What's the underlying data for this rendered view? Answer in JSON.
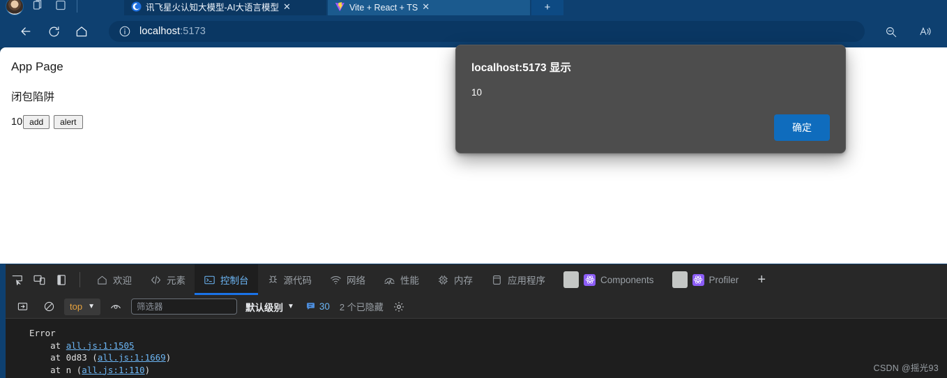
{
  "browser": {
    "tabs": [
      {
        "title": "讯飞星火认知大模型-AI大语言模型",
        "favicon": "spark-icon",
        "close": "✕",
        "active": false
      },
      {
        "title": "Vite + React + TS",
        "favicon": "vite-icon",
        "close": "✕",
        "active": true
      }
    ],
    "new_tab_label": "+",
    "toolbar": {
      "back": "back-arrow-icon",
      "refresh": "refresh-icon",
      "home": "home-icon",
      "site_info": "info-icon",
      "url_host": "localhost",
      "url_port": ":5173",
      "zoom_out": "zoom-out-icon",
      "read_aloud": "read-aloud-icon"
    },
    "chrome_icons": {
      "profile": "avatar",
      "tab_actions": "copy-tabs-icon",
      "split_screen": "split-screen-icon"
    }
  },
  "page": {
    "heading": "App Page",
    "subheading": "闭包陷阱",
    "counter_value": "10",
    "buttons": [
      {
        "label": "add"
      },
      {
        "label": "alert"
      }
    ]
  },
  "dialog": {
    "title": "localhost:5173 显示",
    "message": "10",
    "confirm_label": "确定"
  },
  "devtools": {
    "rail_icons": [
      {
        "name": "inspect-element-icon"
      },
      {
        "name": "device-toolbar-icon"
      },
      {
        "name": "dock-side-icon"
      }
    ],
    "tabs": [
      {
        "label": "欢迎",
        "icon": "home-icon",
        "active": false,
        "type": "icon"
      },
      {
        "label": "元素",
        "icon": "code-brackets-icon",
        "active": false,
        "type": "icon"
      },
      {
        "label": "控制台",
        "icon": "console-terminal-icon",
        "active": true,
        "type": "icon"
      },
      {
        "label": "源代码",
        "icon": "bug-sources-icon",
        "active": false,
        "type": "icon"
      },
      {
        "label": "网络",
        "icon": "wifi-network-icon",
        "active": false,
        "type": "icon"
      },
      {
        "label": "性能",
        "icon": "performance-gauge-icon",
        "active": false,
        "type": "icon"
      },
      {
        "label": "内存",
        "icon": "memory-chip-icon",
        "active": false,
        "type": "icon"
      },
      {
        "label": "应用程序",
        "icon": "application-storage-icon",
        "active": false,
        "type": "icon"
      },
      {
        "label": "Components",
        "icon": "react-atom-icon",
        "active": false,
        "type": "react"
      },
      {
        "label": "Profiler",
        "icon": "react-atom-icon",
        "active": false,
        "type": "react"
      }
    ],
    "more_tabs_label": "+",
    "filterbar": {
      "sidebar_toggle": "console-sidebar-icon",
      "clear_console": "clear-console-icon",
      "context_value": "top",
      "context_caret": "▼",
      "live_expression": "eye-icon",
      "filter_placeholder": "筛选器",
      "level_label": "默认级别",
      "level_caret": "▼",
      "info_icon": "info-message-icon",
      "info_count": "30",
      "hidden_count": "2 个已隐藏",
      "settings": "gear-icon"
    },
    "console_log": {
      "header": "Error",
      "frames": [
        {
          "prefix": "    at ",
          "link": "all.js:1:1505",
          "suffix": ""
        },
        {
          "prefix": "    at 0d83 (",
          "link": "all.js:1:1669",
          "suffix": ")"
        },
        {
          "prefix": "    at n (",
          "link": "all.js:1:110",
          "suffix": ")"
        }
      ]
    }
  },
  "watermark": "CSDN @摇光93",
  "colors": {
    "browser_chrome": "#0e4070",
    "active_tab": "#1b5a8e",
    "devtools_bg": "#282828",
    "console_bg": "#1e1e1e",
    "accent_blue": "#1a73e8",
    "link_blue": "#6cb6f5",
    "context_orange": "#e8a33d",
    "dialog_bg": "#4d4d4d",
    "dialog_button": "#0f6cbd"
  }
}
